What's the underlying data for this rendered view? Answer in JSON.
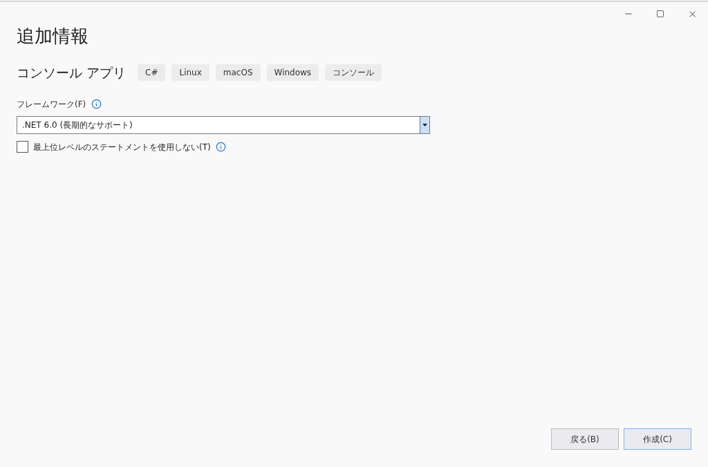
{
  "title": "追加情報",
  "template": {
    "name": "コンソール アプリ",
    "tags": [
      "C#",
      "Linux",
      "macOS",
      "Windows",
      "コンソール"
    ]
  },
  "framework": {
    "label": "フレームワーク(F)",
    "value": ".NET 6.0 (長期的なサポート)"
  },
  "top_level_statements": {
    "label": "最上位レベルのステートメントを使用しない(T)",
    "checked": false
  },
  "buttons": [
    {
      "label": "戻る(B)",
      "focused": false
    },
    {
      "label": "作成(C)",
      "focused": true
    }
  ]
}
